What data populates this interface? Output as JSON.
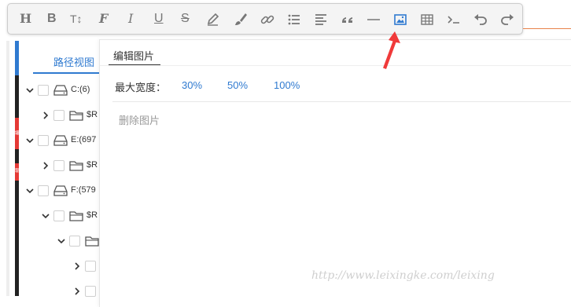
{
  "toolbar": {
    "items": [
      {
        "name": "heading",
        "text": "H"
      },
      {
        "name": "bold",
        "text": "B"
      },
      {
        "name": "font-size",
        "text": "T↕"
      },
      {
        "name": "font-family",
        "text": "F"
      },
      {
        "name": "italic",
        "text": "I"
      },
      {
        "name": "underline",
        "text": "U"
      },
      {
        "name": "strikethrough",
        "text": "S"
      },
      {
        "name": "text-color"
      },
      {
        "name": "background-color"
      },
      {
        "name": "link"
      },
      {
        "name": "list"
      },
      {
        "name": "align"
      },
      {
        "name": "quote"
      },
      {
        "name": "horizontal-rule"
      },
      {
        "name": "image"
      },
      {
        "name": "table"
      },
      {
        "name": "code"
      },
      {
        "name": "undo"
      },
      {
        "name": "redo"
      }
    ]
  },
  "tree": {
    "tab_label": "路径视图",
    "rows": [
      {
        "label": "C:(6)",
        "icon": "drive",
        "expanded": true
      },
      {
        "label": "$R",
        "icon": "folder",
        "expanded": false
      },
      {
        "label": "E:(697",
        "icon": "drive",
        "expanded": true
      },
      {
        "label": "$R",
        "icon": "folder",
        "expanded": false
      },
      {
        "label": "F:(579",
        "icon": "drive",
        "expanded": true
      },
      {
        "label": "$R",
        "icon": "folder",
        "expanded": true
      },
      {
        "label": "",
        "icon": "folder",
        "expanded": true
      },
      {
        "label": "",
        "icon": "none",
        "expanded": false
      },
      {
        "label": "",
        "icon": "none",
        "expanded": false
      }
    ]
  },
  "sidebar_strip": {
    "chars": [
      "编",
      "辑"
    ]
  },
  "image_panel": {
    "title": "编辑图片",
    "max_width_label": "最大宽度：",
    "width_options": [
      "30%",
      "50%",
      "100%"
    ],
    "delete_label": "删除图片"
  },
  "watermark": "http://www.leixingke.com/leixing",
  "colors": {
    "accent": "#2f7ad0",
    "annotation_arrow": "#f03a3a",
    "toolbar_bg": "#f4f4f4"
  }
}
